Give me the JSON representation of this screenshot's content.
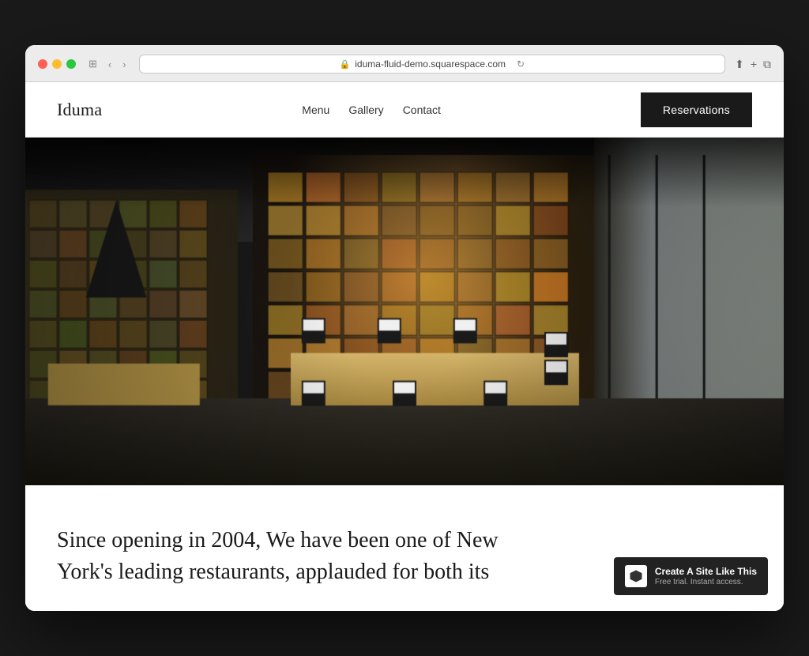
{
  "browser": {
    "url": "iduma-fluid-demo.squarespace.com",
    "back_btn": "‹",
    "forward_btn": "›",
    "reload_icon": "↻",
    "share_icon": "⬆",
    "new_tab_icon": "+",
    "windows_icon": "⧉",
    "view_icon": "⊞"
  },
  "nav": {
    "logo": "Iduma",
    "links": [
      "Menu",
      "Gallery",
      "Contact"
    ],
    "cta_label": "Reservations"
  },
  "hero": {
    "alt": "Restaurant interior with wine wall and dining tables"
  },
  "body": {
    "text_line1": "Since opening in 2004, We have been one of New",
    "text_line2": "York's leading restaurants, applauded for both its"
  },
  "badge": {
    "icon": "✦",
    "main_text": "Create A Site Like This",
    "sub_text": "Free trial. Instant access."
  }
}
